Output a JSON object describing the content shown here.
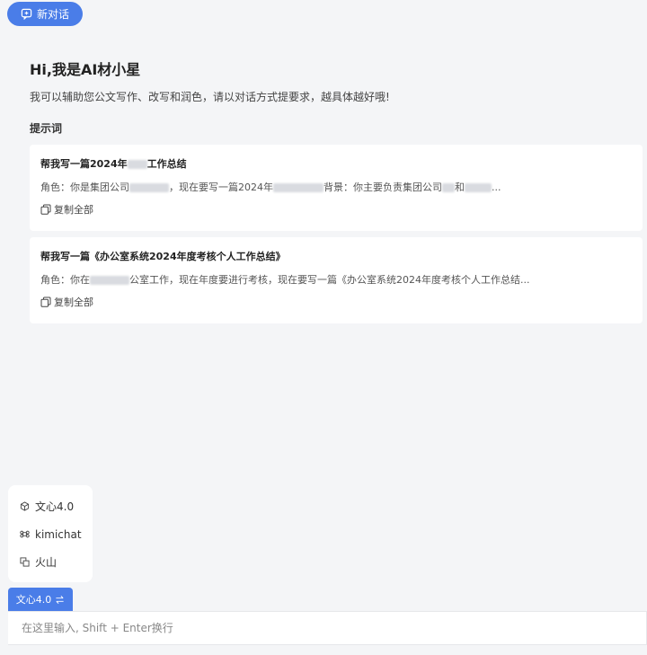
{
  "header": {
    "new_chat_label": "新对话"
  },
  "welcome": {
    "title": "Hi,我是AI材小星",
    "subtitle": "我可以辅助您公文写作、改写和润色，请以对话方式提要求，越具体越好哦!"
  },
  "prompts_section": {
    "title": "提示词",
    "cards": [
      {
        "title_a": "帮我写一篇2024年",
        "title_b": "工作总结",
        "desc_a": "角色：你是集团公司",
        "desc_b": "，现在要写一篇2024年",
        "desc_c": "背景：你主要负责集团公司",
        "desc_d": "和",
        "desc_e": "...",
        "copy_label": "复制全部"
      },
      {
        "title": "帮我写一篇《办公室系统2024年度考核个人工作总结》",
        "desc_a": "角色：你在",
        "desc_b": "公室工作，现在年度要进行考核，现在要写一篇《办公室系统2024年度考核个人工作总结...",
        "copy_label": "复制全部"
      }
    ]
  },
  "model_menu": {
    "items": [
      {
        "label": "文心4.0",
        "icon": "cube-icon"
      },
      {
        "label": "kimichat",
        "icon": "command-icon"
      },
      {
        "label": "火山",
        "icon": "layers-icon"
      }
    ]
  },
  "model_switch": {
    "label": "文心4.0",
    "icon": "swap-icon"
  },
  "chat_input": {
    "placeholder": "在这里输入, Shift + Enter换行",
    "value": ""
  },
  "colors": {
    "accent": "#4a7de8",
    "background": "#f4f5f7",
    "card": "#ffffff"
  }
}
